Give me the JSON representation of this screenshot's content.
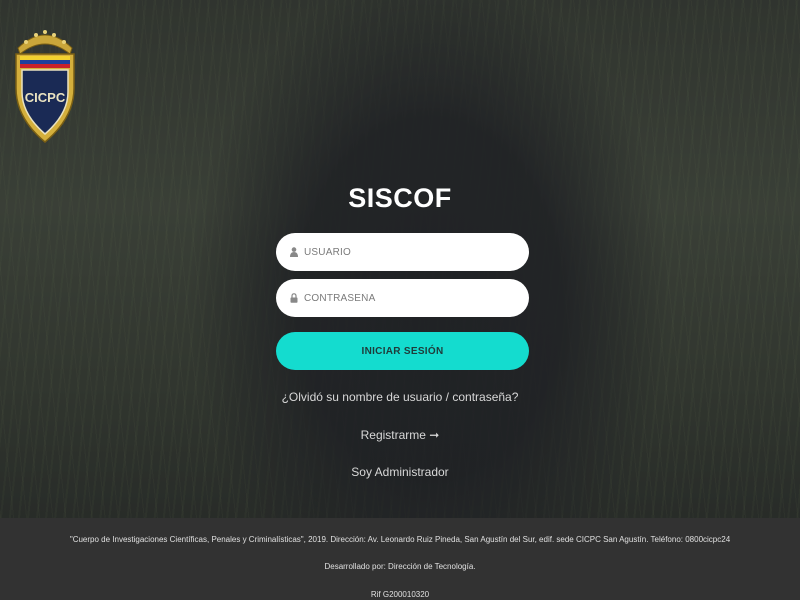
{
  "logo": {
    "text": "CICPC"
  },
  "app": {
    "title": "SISCOF"
  },
  "login": {
    "username_placeholder": "USUARIO",
    "password_placeholder": "CONTRASEÑA",
    "submit_label": "INICIAR SESIÓN"
  },
  "links": {
    "forgot": "¿Olvidó su nombre de usuario / contraseña?",
    "register": "Registrarme ➞",
    "admin": "Soy Administrador"
  },
  "footer": {
    "address": "\"Cuerpo de Investigaciones Científicas, Penales y Criminalísticas\", 2019. Dirección: Av. Leonardo Ruiz Pineda, San Agustín del Sur, edif. sede CICPC San Agustín. Teléfono: 0800cicpc24",
    "developed_by": "Desarrollado por: Dirección de Tecnología.",
    "rif": "Rif G200010320"
  },
  "colors": {
    "accent": "#14dccf",
    "footer_bg": "#323232"
  }
}
